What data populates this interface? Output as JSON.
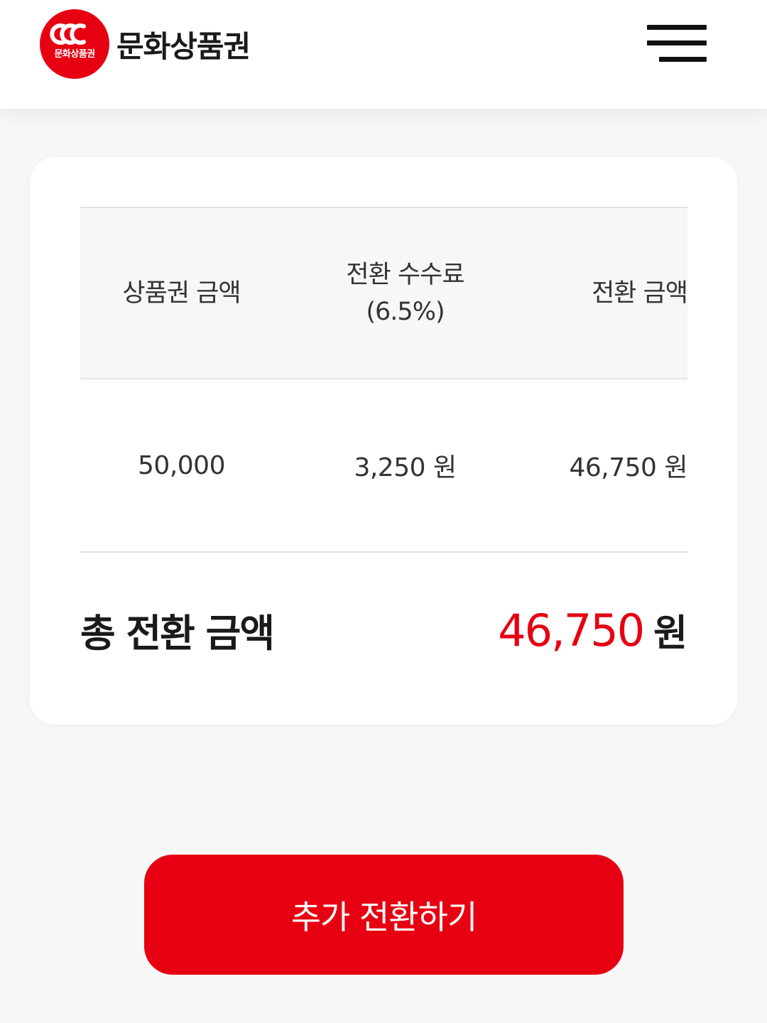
{
  "header": {
    "logo_mark_text": "문화상품권",
    "logo_wordmark": "문화상품권",
    "logo_icon": "culture-voucher-logo-icon",
    "menu_icon": "hamburger-menu-icon"
  },
  "table": {
    "headers": [
      "상품권 금액",
      "전환 수수료\n(6.5%)",
      "전환 금액"
    ],
    "rows": [
      [
        "50,000",
        "3,250 원",
        "46,750 원"
      ]
    ]
  },
  "total": {
    "label": "총 전환 금액",
    "value": "46,750",
    "unit": "원"
  },
  "cta": {
    "label": "추가 전환하기"
  },
  "colors": {
    "brand_red": "#e60012",
    "background": "#f7f7f7",
    "card": "#ffffff"
  }
}
